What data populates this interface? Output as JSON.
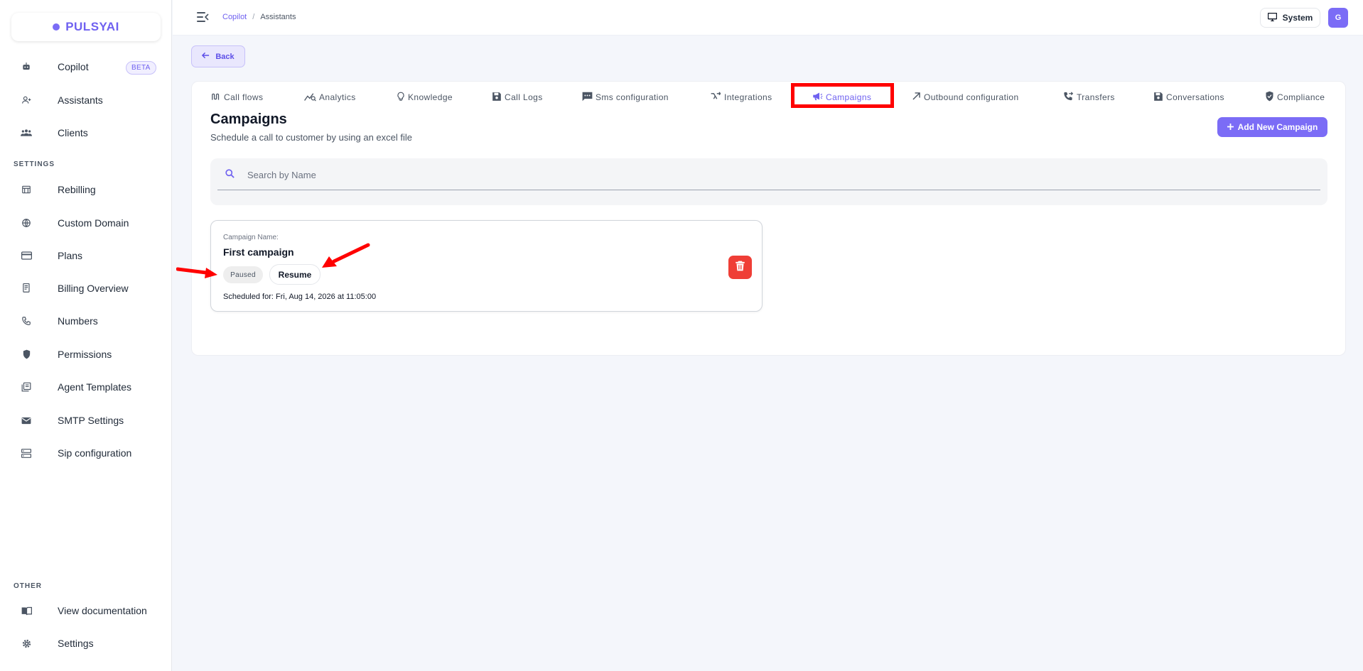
{
  "brand": {
    "name": "PULSYAI",
    "color": "#6f61f0"
  },
  "sidebar": {
    "main_items": [
      {
        "label": "Copilot",
        "icon": "robot-icon",
        "badge": "BETA"
      },
      {
        "label": "Assistants",
        "icon": "person-add-icon"
      },
      {
        "label": "Clients",
        "icon": "group-icon"
      }
    ],
    "settings_title": "SETTINGS",
    "settings_items": [
      {
        "label": "Rebilling",
        "icon": "store-icon"
      },
      {
        "label": "Custom Domain",
        "icon": "globe-icon"
      },
      {
        "label": "Plans",
        "icon": "credit-card-icon"
      },
      {
        "label": "Billing Overview",
        "icon": "receipt-icon"
      },
      {
        "label": "Numbers",
        "icon": "phone-icon"
      },
      {
        "label": "Permissions",
        "icon": "shield-icon"
      },
      {
        "label": "Agent Templates",
        "icon": "library-icon"
      },
      {
        "label": "SMTP Settings",
        "icon": "mail-icon"
      },
      {
        "label": "Sip configuration",
        "icon": "server-icon"
      }
    ],
    "other_title": "OTHER",
    "other_items": [
      {
        "label": "View documentation",
        "icon": "book-icon"
      },
      {
        "label": "Settings",
        "icon": "gear-icon"
      }
    ]
  },
  "topbar": {
    "breadcrumbs": [
      "Copilot",
      "Assistants"
    ],
    "breadcrumb_separator": "/",
    "theme_label": "System",
    "avatar_initial": "G"
  },
  "back_label": "Back",
  "tabs": [
    {
      "label": "Call flows",
      "icon": "flow-icon"
    },
    {
      "label": "Analytics",
      "icon": "analytics-icon"
    },
    {
      "label": "Knowledge",
      "icon": "lightbulb-icon"
    },
    {
      "label": "Call Logs",
      "icon": "save-icon"
    },
    {
      "label": "Sms configuration",
      "icon": "sms-icon"
    },
    {
      "label": "Integrations",
      "icon": "merge-icon"
    },
    {
      "label": "Campaigns",
      "icon": "megaphone-icon",
      "active": true
    },
    {
      "label": "Outbound configuration",
      "icon": "arrow-outward-icon"
    },
    {
      "label": "Transfers",
      "icon": "phone-forward-icon"
    },
    {
      "label": "Conversations",
      "icon": "save-icon"
    },
    {
      "label": "Compliance",
      "icon": "verified-shield-icon"
    }
  ],
  "page": {
    "title": "Campaigns",
    "subtitle": "Schedule a call to customer by using an excel file",
    "add_button": "Add New Campaign",
    "search_placeholder": "Search by Name"
  },
  "campaigns": [
    {
      "name_label": "Campaign Name:",
      "name": "First campaign",
      "status": "Paused",
      "action": "Resume",
      "scheduled": "Scheduled for: Fri, Aug 14, 2026 at 11:05:00"
    }
  ],
  "colors": {
    "accent": "#7b6cf6",
    "delete": "#ef3e36",
    "annotation": "#ff0000",
    "background": "#f4f6fb"
  }
}
